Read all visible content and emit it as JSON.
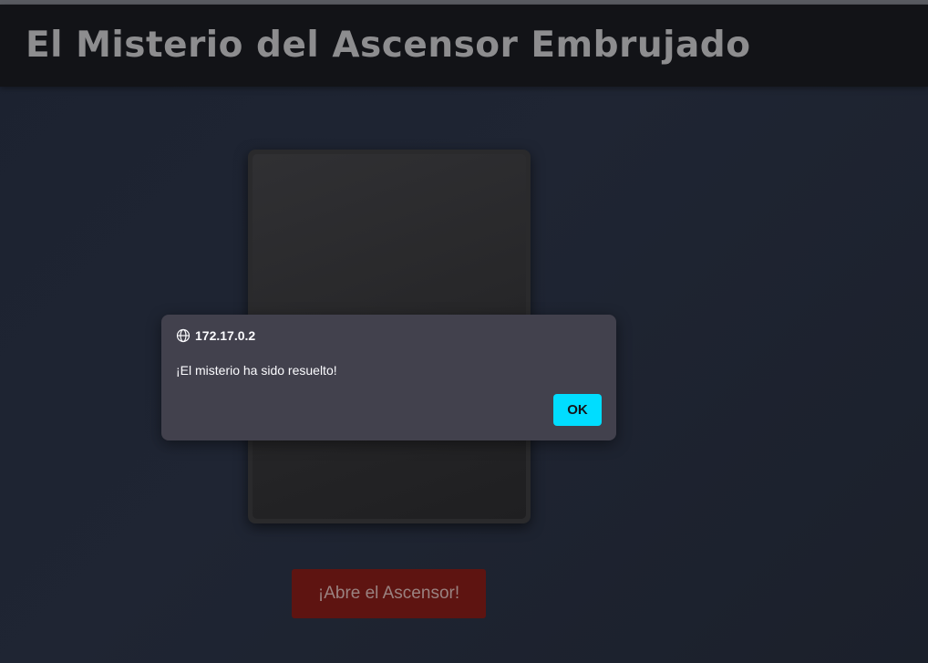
{
  "page": {
    "title": "El Misterio del Ascensor Embrujado",
    "open_button_label": "¡Abre el Ascensor!"
  },
  "dialog": {
    "origin": "172.17.0.2",
    "message": "¡El misterio ha sido resuelto!",
    "ok_label": "OK",
    "icon": "globe-icon"
  },
  "colors": {
    "background": "#1e2431",
    "header": "#121317",
    "button": "#5e1411",
    "dialog": "#42414d",
    "accent": "#00ddff"
  }
}
